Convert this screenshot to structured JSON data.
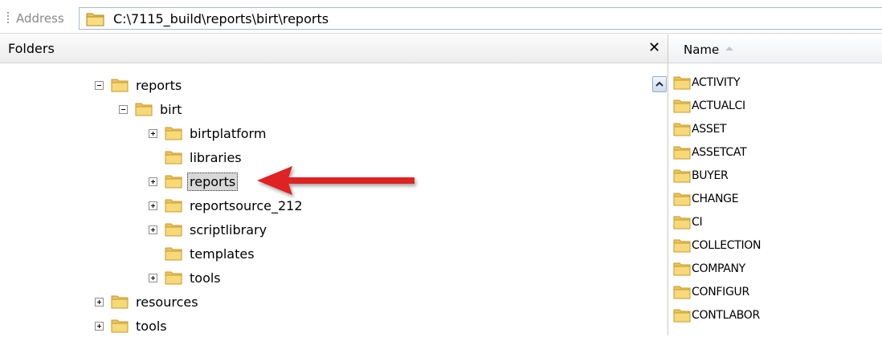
{
  "address": {
    "label": "Address",
    "path": "C:\\7115_build\\reports\\birt\\reports"
  },
  "folders_pane": {
    "title": "Folders",
    "close_glyph": "✕",
    "tree": [
      {
        "label": "reports",
        "expander": "minus"
      },
      {
        "label": "birt",
        "expander": "minus"
      },
      {
        "label": "birtplatform",
        "expander": "plus"
      },
      {
        "label": "libraries",
        "expander": "none"
      },
      {
        "label": "reports",
        "expander": "plus",
        "selected": true
      },
      {
        "label": "reportsource_212",
        "expander": "plus"
      },
      {
        "label": "scriptlibrary",
        "expander": "plus"
      },
      {
        "label": "templates",
        "expander": "none"
      },
      {
        "label": "tools",
        "expander": "plus"
      },
      {
        "label": "resources",
        "expander": "plus"
      },
      {
        "label": "tools",
        "expander": "plus"
      }
    ]
  },
  "file_list": {
    "column_name": "Name",
    "items": [
      "ACTIVITY",
      "ACTUALCI",
      "ASSET",
      "ASSETCAT",
      "BUYER",
      "CHANGE",
      "CI",
      "COLLECTION",
      "COMPANY",
      "CONFIGUR",
      "CONTLABOR"
    ]
  },
  "colors": {
    "folder_fill": "#f7d97a",
    "folder_stroke": "#c79a2a",
    "arrow": "#e02020",
    "selection": "#d8d8d8"
  },
  "icons": {
    "folder": "folder-icon",
    "expand": "plus-box-icon",
    "collapse": "minus-box-icon",
    "sort": "sort-ascending-icon",
    "scroll_up": "scroll-up-icon",
    "close": "close-icon"
  }
}
